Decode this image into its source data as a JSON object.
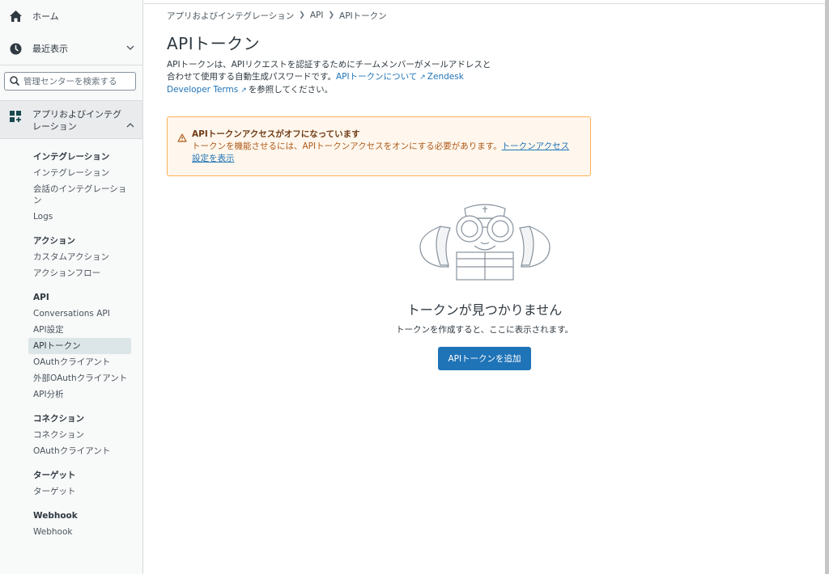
{
  "sidebar": {
    "home_label": "ホーム",
    "recent_label": "最近表示",
    "search_placeholder": "管理センターを検索する",
    "apps_section_label": "アプリおよびインテグレーション",
    "groups": [
      {
        "title": "インテグレーション",
        "items": [
          "インテグレーション",
          "会話のインテグレーション",
          "Logs"
        ]
      },
      {
        "title": "アクション",
        "items": [
          "カスタムアクション",
          "アクションフロー"
        ]
      },
      {
        "title": "API",
        "items": [
          "Conversations API",
          "API設定",
          "APIトークン",
          "OAuthクライアント",
          "外部OAuthクライアント",
          "API分析"
        ]
      },
      {
        "title": "コネクション",
        "items": [
          "コネクション",
          "OAuthクライアント"
        ]
      },
      {
        "title": "ターゲット",
        "items": [
          "ターゲット"
        ]
      },
      {
        "title": "Webhook",
        "items": [
          "Webhook"
        ]
      }
    ],
    "active_item": "APIトークン"
  },
  "breadcrumb": [
    "アプリおよびインテグレーション",
    "API",
    "APIトークン"
  ],
  "page": {
    "title": "APIトークン",
    "description_text": "APIトークンは、APIリクエストを認証するためにチームメンバーがメールアドレスと合わせて使用する自動生成パスワードです。",
    "about_link": "APIトークンについて",
    "terms_link": "Zendesk Developer Terms",
    "description_suffix": "を参照してください。"
  },
  "alert": {
    "title": "APIトークンアクセスがオフになっています",
    "body": "トークンを機能させるには、APIトークンアクセスをオンにする必要があります。",
    "link": "トークンアクセス設定を表示"
  },
  "empty_state": {
    "title": "トークンが見つかりません",
    "subtitle": "トークンを作成すると、ここに表示されます。",
    "button_label": "APIトークンを追加"
  },
  "colors": {
    "accent": "#1f73b7",
    "alert_bg": "#fff7ed",
    "alert_border": "#ffb057",
    "sidebar_bg": "#f8f9f9"
  }
}
